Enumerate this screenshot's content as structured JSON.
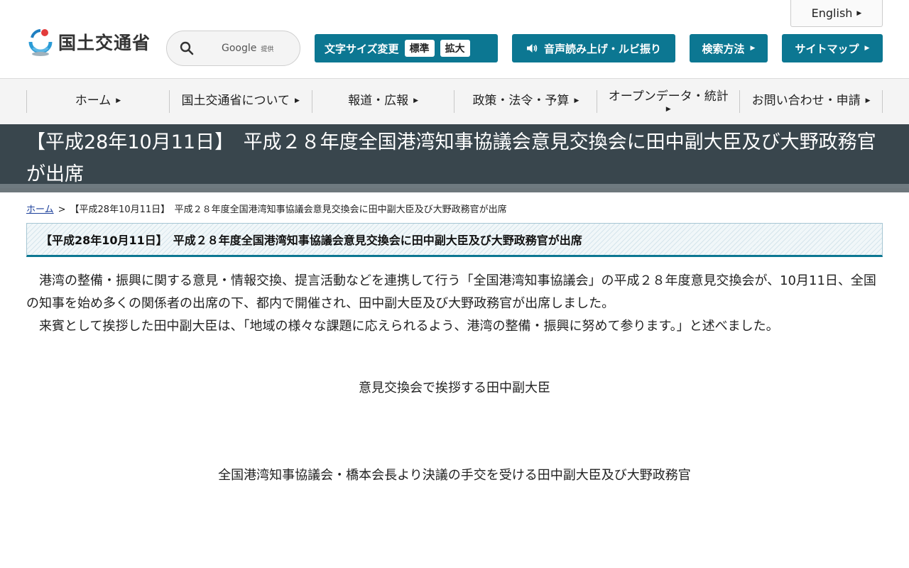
{
  "header": {
    "english_label": "English",
    "logo_text": "国土交通省",
    "search": {
      "google_label": "Google",
      "provider_label": "提供"
    },
    "font_size": {
      "label": "文字サイズ変更",
      "standard": "標準",
      "large": "拡大"
    },
    "voice_label": "音声読み上げ・ルビ振り",
    "howto_label": "検索方法",
    "sitemap_label": "サイトマップ"
  },
  "nav": {
    "items": [
      {
        "label": "ホーム"
      },
      {
        "label": "国土交通省について"
      },
      {
        "label": "報道・広報"
      },
      {
        "label": "政策・法令・予算"
      },
      {
        "label": "オープンデータ・統計"
      },
      {
        "label": "お問い合わせ・申請"
      }
    ]
  },
  "page": {
    "banner_title": "【平成28年10月11日】　平成２８年度全国港湾知事協議会意見交換会に田中副大臣及び大野政務官が出席",
    "breadcrumb": {
      "home": "ホーム",
      "separator": ">",
      "current": "【平成28年10月11日】　平成２８年度全国港湾知事協議会意見交換会に田中副大臣及び大野政務官が出席"
    },
    "heading": "【平成28年10月11日】　平成２８年度全国港湾知事協議会意見交換会に田中副大臣及び大野政務官が出席",
    "paragraph1": "港湾の整備・振興に関する意見・情報交換、提言活動などを連携して行う「全国港湾知事協議会」の平成２８年度意見交換会が、10月11日、全国の知事を始め多くの関係者の出席の下、都内で開催され、田中副大臣及び大野政務官が出席しました。",
    "paragraph2": "来賓として挨拶した田中副大臣は、「地域の様々な課題に応えられるよう、港湾の整備・振興に努めて参ります。」と述べました。",
    "caption1": "意見交換会で挨拶する田中副大臣",
    "caption2": "全国港湾知事協議会・橋本会長より決議の手交を受ける田中副大臣及び大野政務官"
  },
  "colors": {
    "accent": "#0c7792",
    "banner": "#39464d",
    "link": "#1b3f9a"
  }
}
